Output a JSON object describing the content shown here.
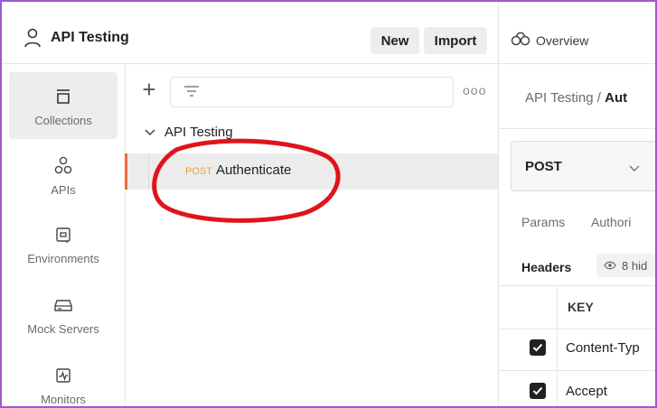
{
  "workspace": {
    "name": "API Testing",
    "icon": "user-icon"
  },
  "topbar": {
    "new_label": "New",
    "import_label": "Import",
    "overview_tab": "Overview"
  },
  "rail": {
    "items": [
      {
        "label": "Collections",
        "icon": "collections-icon",
        "active": true
      },
      {
        "label": "APIs",
        "icon": "apis-icon"
      },
      {
        "label": "Environments",
        "icon": "environments-icon"
      },
      {
        "label": "Mock Servers",
        "icon": "mock-servers-icon"
      },
      {
        "label": "Monitors",
        "icon": "monitors-icon"
      }
    ]
  },
  "collections": {
    "folder": "API Testing",
    "request": {
      "method": "POST",
      "name": "Authenticate"
    },
    "filter_placeholder": ""
  },
  "request_panel": {
    "breadcrumb_parent": "API Testing",
    "breadcrumb_sep": "/",
    "breadcrumb_current": "Aut",
    "method": "POST",
    "tabs": [
      "Params",
      "Authori"
    ],
    "headers_tab": "Headers",
    "hidden_badge": "8 hid",
    "table": {
      "key_header": "KEY",
      "rows": [
        {
          "key": "Content-Typ",
          "checked": true
        },
        {
          "key": "Accept",
          "checked": true
        }
      ]
    }
  },
  "colors": {
    "accent": "#f26b3a",
    "post_method": "#e8a23c",
    "annotation": "#e0141c",
    "frame": "#9b59d0"
  }
}
